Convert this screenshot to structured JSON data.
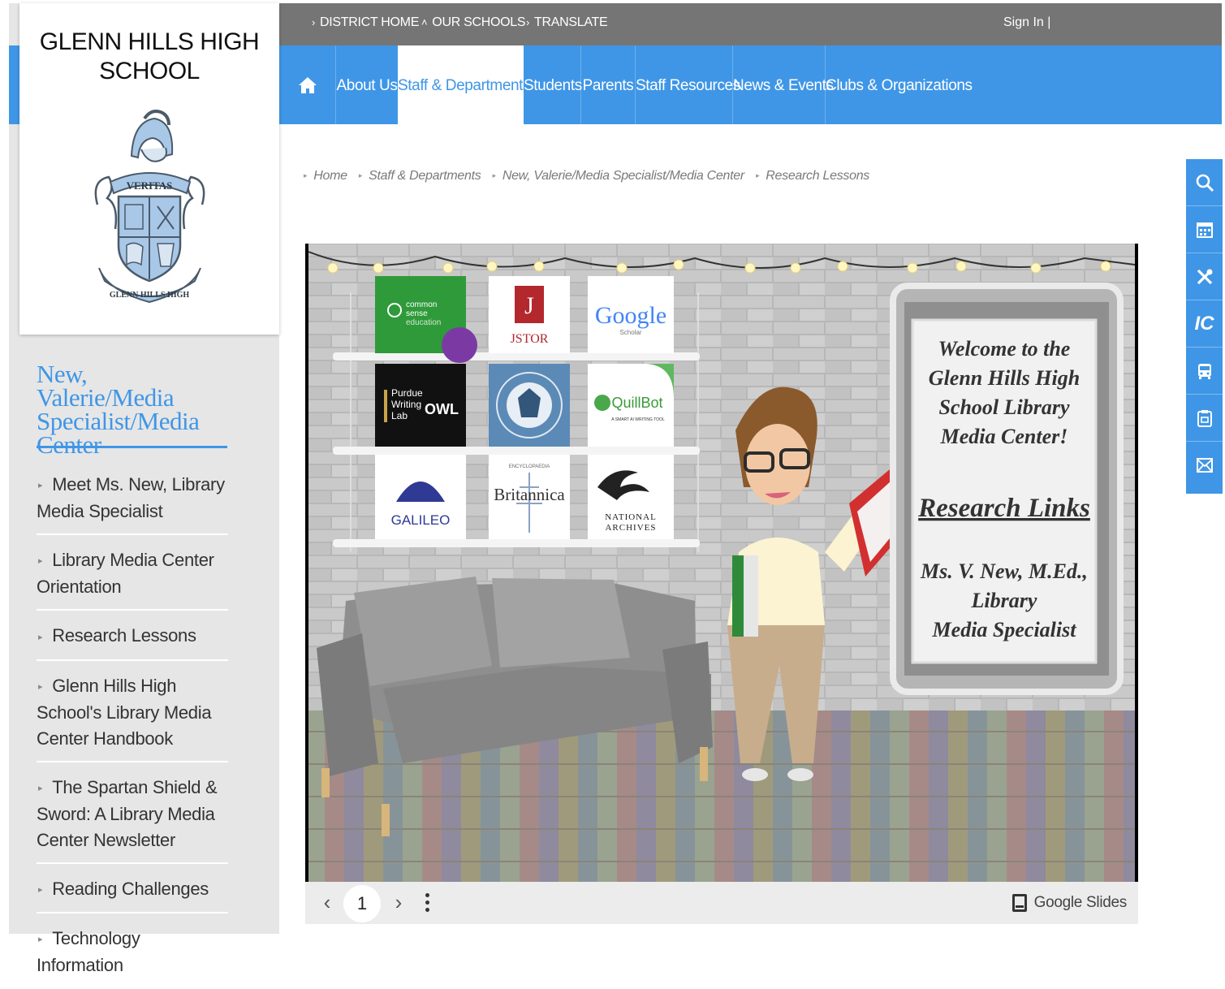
{
  "utility": {
    "district_home": "DISTRICT HOME",
    "our_schools": "OUR SCHOOLS",
    "translate": "TRANSLATE",
    "sign_in": "Sign In |"
  },
  "school": {
    "name": "GLENN HILLS HIGH SCHOOL",
    "crest_banner_top": "VERITAS",
    "crest_banner_bottom": "GLENN HILLS HIGH"
  },
  "nav": {
    "home_icon": "home-icon",
    "items": [
      "About Us",
      "Staff & Departments",
      "Students",
      "Parents",
      "Staff Resources",
      "News & Events",
      "Clubs & Organizations"
    ],
    "active": "Staff & Departments"
  },
  "breadcrumb": [
    "Home",
    "Staff & Departments",
    "New, Valerie/Media Specialist/Media Center",
    "Research Lessons"
  ],
  "sidebar": {
    "title": "New, Valerie/Media Specialist/Media Center",
    "items": [
      "Meet Ms. New, Library Media Specialist",
      "Library Media Center Orientation",
      "Research Lessons",
      "Glenn Hills High School's Library Media Center Handbook",
      "The Spartan Shield & Sword: A Library Media Center Newsletter",
      "Reading Challenges",
      "Technology Information"
    ]
  },
  "slide": {
    "tiles": {
      "common_sense": [
        "common",
        "sense",
        "education"
      ],
      "jstor": "JSTOR",
      "google": "Google",
      "google_sub": "Scholar",
      "purdue": [
        "Purdue",
        "Writing",
        "Lab"
      ],
      "owl": "OWL",
      "quillbot": "QuillBot",
      "quillbot_sub": "A SMART AI WRITING TOOL",
      "galileo": "GALILEO",
      "britannica": "Britannica",
      "britannica_sub": "ENCYCLOPAEDIA",
      "national_archives": [
        "NATIONAL",
        "ARCHIVES"
      ]
    },
    "frame": {
      "welcome": [
        "Welcome to the",
        "Glenn Hills High",
        "School Library",
        "Media Center!"
      ],
      "links": "Research Links",
      "author": [
        "Ms. V. New, M.Ed.,",
        "Library",
        "Media Specialist"
      ]
    }
  },
  "viewer": {
    "page": "1",
    "prev_icon": "chevron-left-icon",
    "next_icon": "chevron-right-icon",
    "menu_icon": "more-vertical-icon",
    "brand": "Google Slides"
  },
  "tools": {
    "icons": [
      "search-icon",
      "calendar-icon",
      "tools-icon",
      "ic-icon",
      "bus-icon",
      "clipboard-icon",
      "mail-icon"
    ],
    "ic_label": "IC"
  },
  "colors": {
    "brand_blue": "#3f96e6",
    "utility_gray": "#757575",
    "sidebar_gray": "#e6e6e6"
  }
}
